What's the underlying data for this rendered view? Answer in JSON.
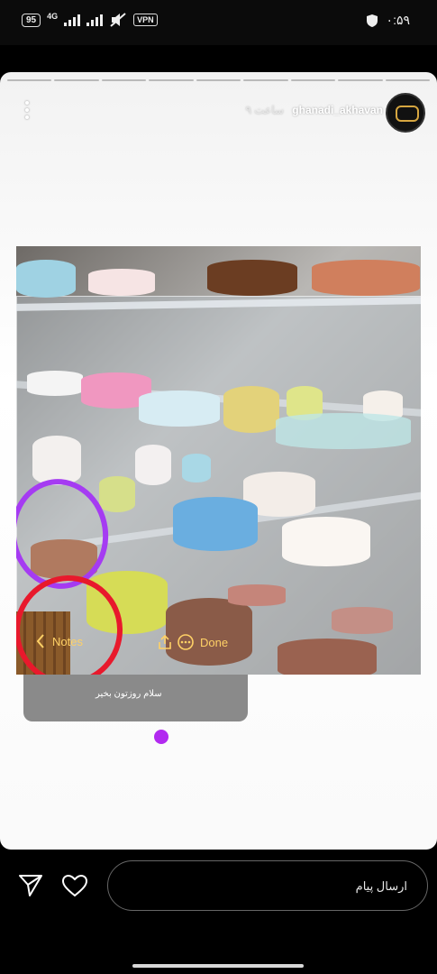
{
  "status_bar": {
    "battery": "95",
    "network": "4G",
    "vpn": "VPN",
    "time": "۰:۵۹",
    "icons": [
      "signal-icon",
      "mute-icon",
      "shield-icon"
    ]
  },
  "story": {
    "username": "ghanadi_akhavan",
    "time_ago": "۹ ساعت",
    "photo_alt_colors": {
      "marker_purple": "#a53bf2",
      "marker_red": "#e8192c",
      "dot": "#b22af0"
    },
    "photo_toolbar": {
      "notes_label": "Notes",
      "done_label": "Done"
    },
    "note_text": "سلام روزتون بخیر"
  },
  "bottom_bar": {
    "message_placeholder": "ارسال پیام",
    "icons": [
      "send-icon",
      "heart-icon"
    ]
  }
}
